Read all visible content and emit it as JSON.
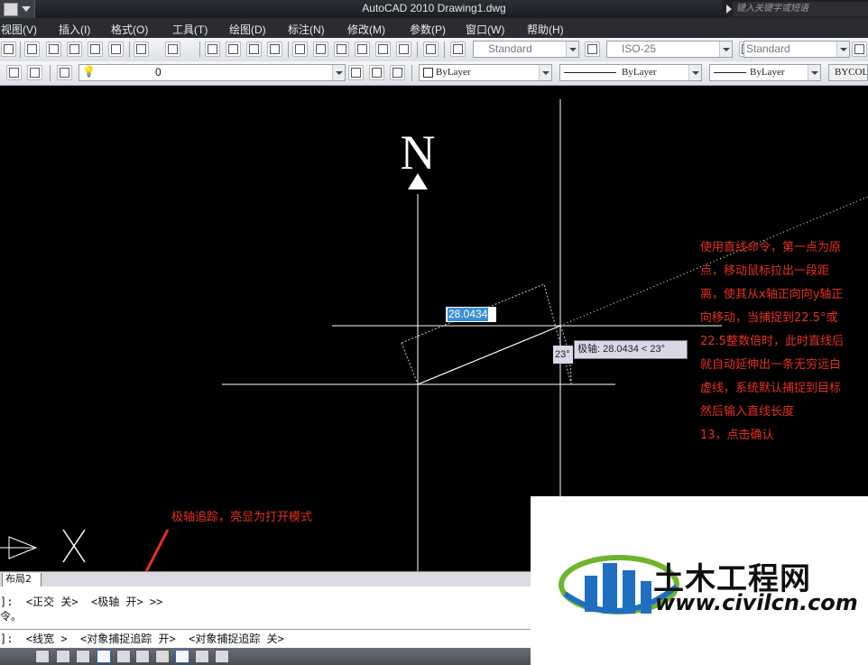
{
  "window": {
    "title": "AutoCAD 2010    Drawing1.dwg",
    "search_placeholder": "键入关键字或短语"
  },
  "menu": [
    "视图(V)",
    "插入(I)",
    "格式(O)",
    "工具(T)",
    "绘图(D)",
    "标注(N)",
    "修改(M)",
    "参数(P)",
    "窗口(W)",
    "帮助(H)"
  ],
  "toolbar1": {
    "text_style": "Standard",
    "dim_style": "ISO-25",
    "table_style": "Standard"
  },
  "toolbar2": {
    "layer": "0",
    "color": "ByLayer",
    "linetype": "ByLayer",
    "lineweight": "ByLayer",
    "plot_style": "BYCOLOR"
  },
  "drawing": {
    "north_label": "N",
    "dynamic_input_value": "28.0434",
    "angle_tooltip": "23°",
    "polar_tooltip": "极轴: 28.0434 < 23°"
  },
  "annotation": {
    "lines": [
      "使用直线命令，第一点为原",
      "点，移动鼠标拉出一段距",
      "离，使其从x轴正向向y轴正",
      "向移动，当捕捉到22.5°或",
      "22.5整数倍时，此时直线后",
      "就自动延伸出一条无穷远白",
      "虚线，系统默认捕捉到目标",
      " 然后输入直线长度",
      " 13，点击确认"
    ],
    "polar_note": "极轴追踪，亮显为打开模式"
  },
  "tabs": {
    "layout2": "布局2"
  },
  "command": {
    "line1": "\u0000]:  <正交 关>  <极轴 开> >>",
    "line2": "令。",
    "line3": "]:  <线宽 >  <对象捕捉追踪 开>  <对象捕捉追踪 关>"
  },
  "watermark": {
    "name": "土木工程网",
    "url": "www.civilcn.com"
  },
  "colors": {
    "annotation_red": "#e63022",
    "selection_blue": "#3a8fd7",
    "logo_blue": "#1f6fc0",
    "logo_green": "#6fb52c"
  }
}
